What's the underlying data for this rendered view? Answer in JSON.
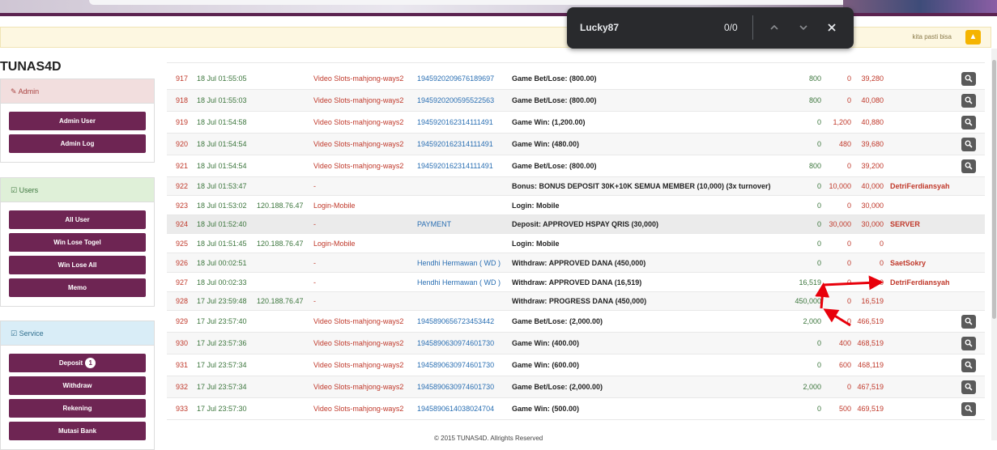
{
  "notice": {
    "text": "kita pasti bisa"
  },
  "brand": {
    "logo": "TUNAS4D"
  },
  "sidebar": {
    "admin": {
      "title": "Admin",
      "buttons": [
        "Admin User",
        "Admin Log"
      ]
    },
    "users": {
      "title": "Users",
      "buttons": [
        "All User",
        "Win Lose Togel",
        "Win Lose All",
        "Memo"
      ]
    },
    "service": {
      "title": "Service",
      "buttons": [
        "Deposit",
        "Withdraw",
        "Rekening",
        "Mutasi Bank"
      ],
      "deposit_badge": "1"
    }
  },
  "find": {
    "query": "Lucky87",
    "count": "0/0"
  },
  "rows": [
    {
      "no": "917",
      "time": "18 Jul 01:55:05",
      "ip": "",
      "game": "Video Slots-mahjong-ways2",
      "ref": "1945920209676189697",
      "desc": "Game Bet/Lose: (800.00)",
      "debit": "800",
      "credit": "0",
      "bal": "39,280",
      "user": "",
      "search": true
    },
    {
      "no": "918",
      "time": "18 Jul 01:55:03",
      "ip": "",
      "game": "Video Slots-mahjong-ways2",
      "ref": "1945920200595522563",
      "desc": "Game Bet/Lose: (800.00)",
      "debit": "800",
      "credit": "0",
      "bal": "40,080",
      "user": "",
      "search": true
    },
    {
      "no": "919",
      "time": "18 Jul 01:54:58",
      "ip": "",
      "game": "Video Slots-mahjong-ways2",
      "ref": "1945920162314111491",
      "desc": "Game Win: (1,200.00)",
      "debit": "0",
      "credit": "1,200",
      "bal": "40,880",
      "user": "",
      "search": true
    },
    {
      "no": "920",
      "time": "18 Jul 01:54:54",
      "ip": "",
      "game": "Video Slots-mahjong-ways2",
      "ref": "1945920162314111491",
      "desc": "Game Win: (480.00)",
      "debit": "0",
      "credit": "480",
      "bal": "39,680",
      "user": "",
      "search": true
    },
    {
      "no": "921",
      "time": "18 Jul 01:54:54",
      "ip": "",
      "game": "Video Slots-mahjong-ways2",
      "ref": "1945920162314111491",
      "desc": "Game Bet/Lose: (800.00)",
      "debit": "800",
      "credit": "0",
      "bal": "39,200",
      "user": "",
      "search": true
    },
    {
      "no": "922",
      "time": "18 Jul 01:53:47",
      "ip": "",
      "game": "-",
      "ref": "",
      "desc": "Bonus: BONUS DEPOSIT 30K+10K SEMUA MEMBER (10,000) (3x turnover)",
      "debit": "0",
      "credit": "10,000",
      "bal": "40,000",
      "user": "DetriFerdiansyah",
      "search": false
    },
    {
      "no": "923",
      "time": "18 Jul 01:53:02",
      "ip": "120.188.76.47",
      "game": "Login-Mobile",
      "ref": "",
      "desc": "Login: Mobile",
      "debit": "0",
      "credit": "0",
      "bal": "30,000",
      "user": "",
      "search": false
    },
    {
      "no": "924",
      "time": "18 Jul 01:52:40",
      "ip": "",
      "game": "-",
      "ref": "PAYMENT",
      "desc": "Deposit: APPROVED HSPAY QRIS (30,000)",
      "debit": "0",
      "credit": "30,000",
      "bal": "30,000",
      "user": "SERVER",
      "search": false
    },
    {
      "no": "925",
      "time": "18 Jul 01:51:45",
      "ip": "120.188.76.47",
      "game": "Login-Mobile",
      "ref": "",
      "desc": "Login: Mobile",
      "debit": "0",
      "credit": "0",
      "bal": "0",
      "user": "",
      "search": false
    },
    {
      "no": "926",
      "time": "18 Jul 00:02:51",
      "ip": "",
      "game": "-",
      "ref": "Hendhi Hermawan ( WD )",
      "desc": "Withdraw: APPROVED DANA (450,000)",
      "debit": "0",
      "credit": "0",
      "bal": "0",
      "user": "SaetSokry",
      "search": false
    },
    {
      "no": "927",
      "time": "18 Jul 00:02:33",
      "ip": "",
      "game": "-",
      "ref": "Hendhi Hermawan ( WD )",
      "desc": "Withdraw: APPROVED DANA (16,519)",
      "debit": "16,519",
      "credit": "0",
      "bal": "0",
      "user": "DetriFerdiansyah",
      "search": false
    },
    {
      "no": "928",
      "time": "17 Jul 23:59:48",
      "ip": "120.188.76.47",
      "game": "-",
      "ref": "",
      "desc": "Withdraw: PROGRESS DANA (450,000)",
      "debit": "450,000",
      "credit": "0",
      "bal": "16,519",
      "user": "",
      "search": false
    },
    {
      "no": "929",
      "time": "17 Jul 23:57:40",
      "ip": "",
      "game": "Video Slots-mahjong-ways2",
      "ref": "1945890656723453442",
      "desc": "Game Bet/Lose: (2,000.00)",
      "debit": "2,000",
      "credit": "0",
      "bal": "466,519",
      "user": "",
      "search": true
    },
    {
      "no": "930",
      "time": "17 Jul 23:57:36",
      "ip": "",
      "game": "Video Slots-mahjong-ways2",
      "ref": "1945890630974601730",
      "desc": "Game Win: (400.00)",
      "debit": "0",
      "credit": "400",
      "bal": "468,519",
      "user": "",
      "search": true
    },
    {
      "no": "931",
      "time": "17 Jul 23:57:34",
      "ip": "",
      "game": "Video Slots-mahjong-ways2",
      "ref": "1945890630974601730",
      "desc": "Game Win: (600.00)",
      "debit": "0",
      "credit": "600",
      "bal": "468,119",
      "user": "",
      "search": true
    },
    {
      "no": "932",
      "time": "17 Jul 23:57:34",
      "ip": "",
      "game": "Video Slots-mahjong-ways2",
      "ref": "1945890630974601730",
      "desc": "Game Bet/Lose: (2,000.00)",
      "debit": "2,000",
      "credit": "0",
      "bal": "467,519",
      "user": "",
      "search": true
    },
    {
      "no": "933",
      "time": "17 Jul 23:57:30",
      "ip": "",
      "game": "Video Slots-mahjong-ways2",
      "ref": "1945890614038024704",
      "desc": "Game Win: (500.00)",
      "debit": "0",
      "credit": "500",
      "bal": "469,519",
      "user": "",
      "search": true
    }
  ],
  "footer": "© 2015 TUNAS4D. Allrights Reserved",
  "colors": {
    "brand_purple": "#6e2553",
    "annotation_red": "#e8000b"
  }
}
